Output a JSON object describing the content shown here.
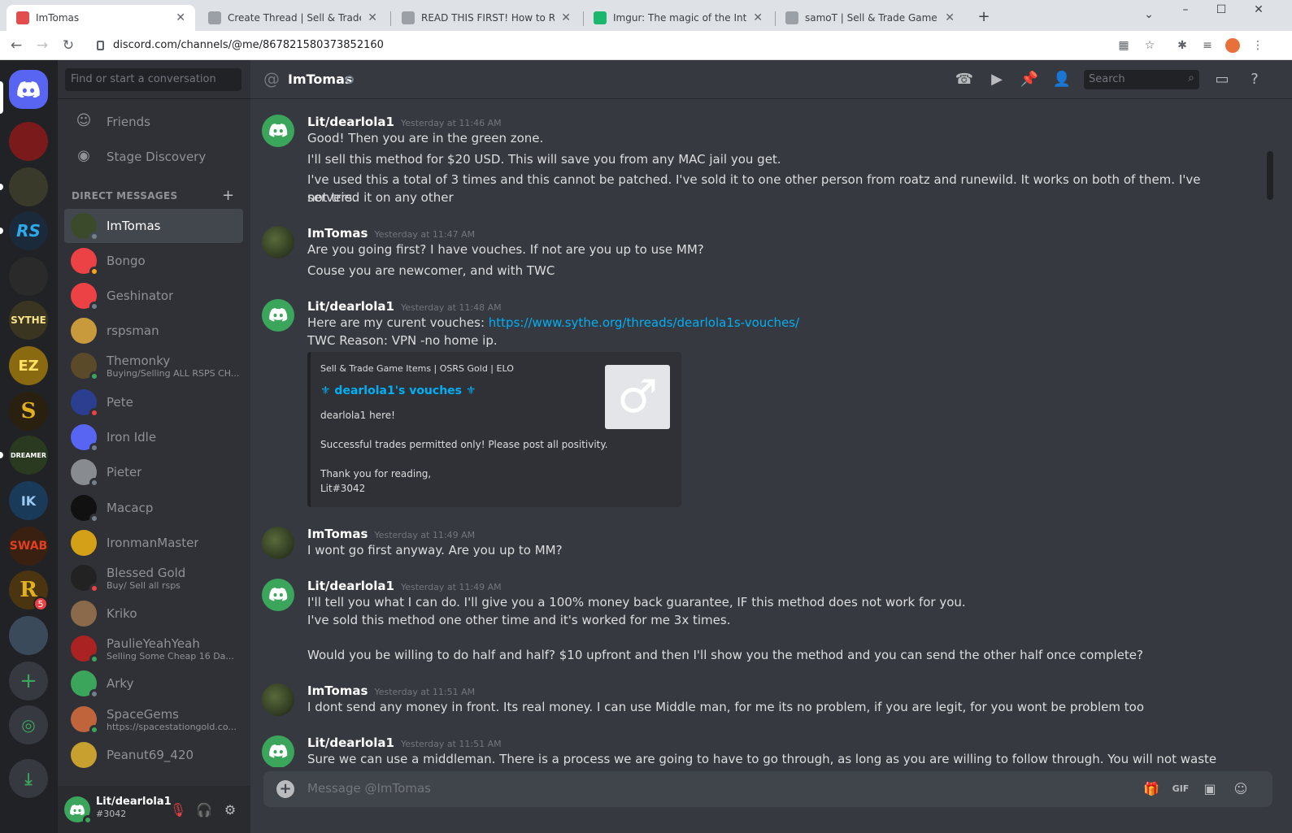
{
  "browser": {
    "tabs": [
      {
        "title": "ImTomas",
        "color": "#5865f2"
      },
      {
        "title": "Create Thread | Sell & Trade Gam",
        "color": "#9aa0a6"
      },
      {
        "title": "READ THIS FIRST! How to Report",
        "color": "#9aa0a6"
      },
      {
        "title": "Imgur: The magic of the Internet",
        "color": "#1bb76e"
      },
      {
        "title": "samoT | Sell & Trade Game Items",
        "color": "#9aa0a6"
      }
    ],
    "url": "discord.com/channels/@me/867821580373852160"
  },
  "sidebar": {
    "search_placeholder": "Find or start a conversation",
    "nav": [
      {
        "label": "Friends",
        "icon": "friends-icon"
      },
      {
        "label": "Stage Discovery",
        "icon": "stage-icon"
      }
    ],
    "dm_header": "DIRECT MESSAGES",
    "dms": [
      {
        "name": "ImTomas",
        "sub": "",
        "color": "#3b4a2a",
        "status": "#747f8d"
      },
      {
        "name": "Bongo",
        "sub": "",
        "color": "#ed4245",
        "status": "#faa61a"
      },
      {
        "name": "Geshinator",
        "sub": "",
        "color": "#ed4245",
        "status": "#747f8d"
      },
      {
        "name": "rspsman",
        "sub": "",
        "color": "#c89a3c",
        "status": ""
      },
      {
        "name": "Themonky",
        "sub": "Buying/Selling ALL RSPS CH...",
        "color": "#5a4a2a",
        "status": "#3ba55c"
      },
      {
        "name": "Pete",
        "sub": "",
        "color": "#2c3e8f",
        "status": "#ed4245"
      },
      {
        "name": "Iron Idle",
        "sub": "",
        "color": "#5865f2",
        "status": "#747f8d"
      },
      {
        "name": "Pieter",
        "sub": "",
        "color": "#888c90",
        "status": "#747f8d"
      },
      {
        "name": "Macacp",
        "sub": "",
        "color": "#111111",
        "status": "#747f8d"
      },
      {
        "name": "IronmanMaster",
        "sub": "",
        "color": "#d4a017",
        "status": ""
      },
      {
        "name": "Blessed Gold",
        "sub": "Buy/ Sell all rsps",
        "color": "#222222",
        "status": "#ed4245"
      },
      {
        "name": "Kriko",
        "sub": "",
        "color": "#8a6a4a",
        "status": ""
      },
      {
        "name": "PaulieYeahYeah",
        "sub": "Selling Some Cheap 16 Da...",
        "color": "#aa2222",
        "status": "#3ba55c"
      },
      {
        "name": "Arky",
        "sub": "",
        "color": "#3ba55c",
        "status": "#747f8d"
      },
      {
        "name": "SpaceGems",
        "sub": "https://spacestationgold.co...",
        "color": "#c0643c",
        "status": "#3ba55c"
      },
      {
        "name": "Peanut69_420",
        "sub": "",
        "color": "#c8a030",
        "status": ""
      }
    ],
    "user": {
      "name": "Lit/dearlola1",
      "tag": "#3042"
    }
  },
  "rail": {
    "servers": [
      {
        "label": "",
        "color": "#5865f2"
      },
      {
        "label": "",
        "color": "#7a1a1a"
      },
      {
        "label": "",
        "color": "#3a3a2a"
      },
      {
        "label": "RS",
        "color": "#1a2a3a"
      },
      {
        "label": "",
        "color": "#2a2a2a"
      },
      {
        "label": "SYTHE",
        "color": "#3a3520"
      },
      {
        "label": "EZ",
        "color": "#8a6a10"
      },
      {
        "label": "S",
        "color": "#2a2010"
      },
      {
        "label": "DREAMER",
        "color": "#2a3a20"
      },
      {
        "label": "IK",
        "color": "#1a3a5a"
      },
      {
        "label": "SWAB",
        "color": "#3a2010"
      },
      {
        "label": "R",
        "color": "#4a3510"
      },
      {
        "label": "",
        "color": "#3a4a5a"
      }
    ],
    "badge": "5"
  },
  "channel": {
    "name": "ImTomas"
  },
  "search_placeholder": "Search",
  "messages": [
    {
      "author": "Lit/dearlola1",
      "time": "Yesterday at 11:46 AM",
      "lines": [
        "Good! Then you are in the green zone.",
        "I'll sell this method for $20 USD. This will save you from any MAC jail you get.",
        "I've used this a total of 3 times and this cannot be patched. I've sold it to one other person from roatz and runewild. It works on both of them. I've not tried it on any other",
        "servers."
      ]
    },
    {
      "author": "ImTomas",
      "time": "Yesterday at 11:47 AM",
      "lines": [
        "Are you going first? I have vouches. If not are you up to use MM?",
        "Couse you are newcomer, and with TWC"
      ]
    },
    {
      "author": "Lit/dearlola1",
      "time": "Yesterday at 11:48 AM",
      "lines": [
        "Here are my curent vouches: ",
        "TWC Reason: VPN -no home ip."
      ],
      "link": "https://www.sythe.org/threads/dearlola1s-vouches/"
    },
    {
      "author": "ImTomas",
      "time": "Yesterday at 11:49 AM",
      "lines": [
        "I wont go first anyway. Are you up to MM?"
      ]
    },
    {
      "author": "Lit/dearlola1",
      "time": "Yesterday at 11:49 AM",
      "lines": [
        "I'll tell you what I can do. I'll give you a 100% money back guarantee, IF this method does not work for you.",
        "I've sold this method one other time and it's worked for me 3x times.",
        "Would you be willing to do half and half? $10 upfront and then I'll show you the method and you can send the other half once complete?"
      ]
    },
    {
      "author": "ImTomas",
      "time": "Yesterday at 11:51 AM",
      "lines": [
        "I dont send any money in front. Its real money. I can use Middle man, for me its no problem, if you are legit, for you wont be problem too"
      ]
    },
    {
      "author": "Lit/dearlola1",
      "time": "Yesterday at 11:51 AM",
      "lines": [
        "Sure we can use a middleman. There is a process we are going to have to go through, as long as you are willing to follow through. You will not waste my time, correct?"
      ]
    }
  ],
  "embed": {
    "provider": "Sell & Trade Game Items | OSRS Gold | ELO",
    "title": "⚜ dearlola1's vouches ⚜",
    "desc1": "dearlola1 here!",
    "desc2": "Successful trades permitted only! Please post all positivity.",
    "desc3": "Thank you for reading,",
    "desc4": "Lit#3042"
  },
  "composer": {
    "placeholder": "Message @ImTomas"
  }
}
